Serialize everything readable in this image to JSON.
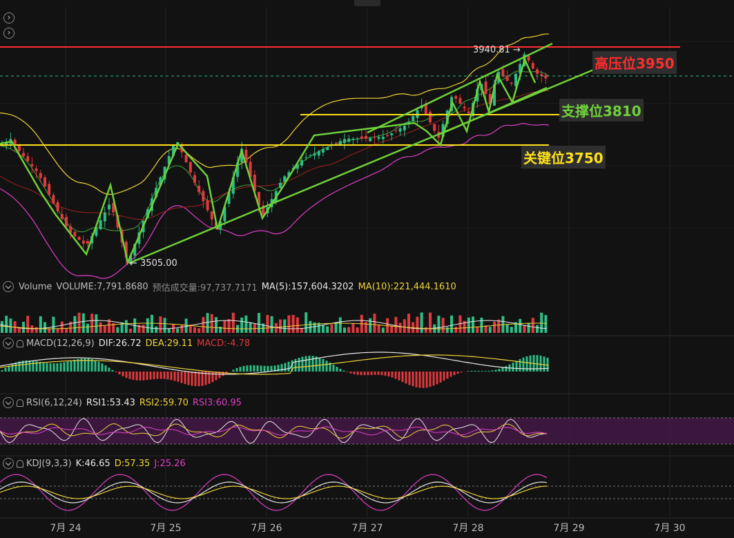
{
  "chart_data": {
    "type": "candlestick",
    "x_tick_labels": [
      "7月 24",
      "7月 25",
      "7月 26",
      "7月 27",
      "7月 28",
      "7月 29",
      "7月 30"
    ],
    "price_annotations": {
      "high_label": "3940.81 →",
      "high_value": 3940.81,
      "low_label": "← 3505.00",
      "low_value": 3505.0
    },
    "levels": [
      {
        "label": "高压位3950",
        "value": 3950,
        "color": "#ff2d2d"
      },
      {
        "label": "支撑位3810",
        "value": 3810,
        "color": "#6fd13a"
      },
      {
        "label": "关键位3750",
        "value": 3750,
        "color": "#ffe11a"
      }
    ],
    "indicators": {
      "volume": {
        "name": "Volume",
        "items": [
          "VOLUME:7,791.8680",
          "预估成交量:97,737.7171",
          "MA(5):157,604.3202",
          "MA(10):221,444.1610"
        ]
      },
      "macd": {
        "name": "MACD(12,26,9)",
        "items": [
          "DIF:26.72",
          "DEA:29.11",
          "MACD:-4.78"
        ]
      },
      "rsi": {
        "name": "RSI(6,12,24)",
        "items": [
          "RSI1:53.43",
          "RSI2:59.70",
          "RSI3:60.95"
        ]
      },
      "kdj": {
        "name": "KDJ(9,3,3)",
        "items": [
          "K:46.65",
          "D:57.35",
          "J:25.26"
        ]
      }
    }
  },
  "colors": {
    "up": "#2ebd85",
    "down": "#e0393e",
    "ma_yellow": "#f0d43a",
    "ma_pink": "#e040c8",
    "green_trend": "#6fd13a",
    "white_line": "#e8e8e8"
  },
  "ui": {
    "collapse_icon_1": "›",
    "collapse_icon_2": "›"
  }
}
